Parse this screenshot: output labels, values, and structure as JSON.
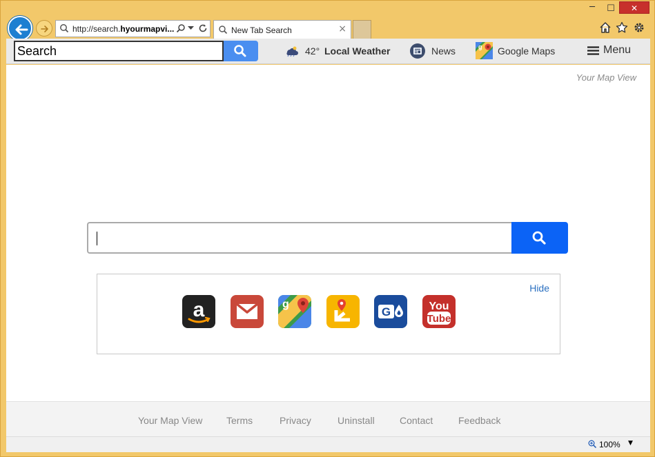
{
  "window": {
    "minimize": "─",
    "maximize": "☐",
    "close": "✕"
  },
  "address_bar": {
    "url_prefix": "http://search.",
    "url_bold": "hyourmapvi...",
    "search_icon": "search-icon",
    "dropdown_icon": "chevron-down-icon",
    "refresh_icon": "refresh-icon"
  },
  "tab": {
    "label": "New Tab Search",
    "close": "×"
  },
  "toolbar": {
    "search_value": "Search",
    "weather": {
      "temp": "42°",
      "label": "Local Weather"
    },
    "news": "News",
    "maps": "Google Maps",
    "menu": "Menu"
  },
  "content": {
    "brand": "Your Map View",
    "search_placeholder": "",
    "hide": "Hide",
    "shortcuts": [
      {
        "name": "amazon",
        "icon": "amazon-icon",
        "color": "#222222"
      },
      {
        "name": "gmail",
        "icon": "gmail-icon",
        "color": "#c9483a"
      },
      {
        "name": "google-maps",
        "icon": "google-maps-icon",
        "color": "#3d9b49"
      },
      {
        "name": "directions",
        "icon": "directions-icon",
        "color": "#f7b500"
      },
      {
        "name": "gasbuddy",
        "icon": "gasbuddy-icon",
        "color": "#1a4c9c"
      },
      {
        "name": "youtube",
        "icon": "youtube-icon",
        "color": "#c4302b"
      }
    ]
  },
  "footer": {
    "links": [
      "Your Map View",
      "Terms",
      "Privacy",
      "Uninstall",
      "Contact",
      "Feedback"
    ]
  },
  "status": {
    "zoom": "100%",
    "zoom_dropdown": "▼"
  },
  "colors": {
    "frame": "#f2c86a",
    "search_button": "#0b63f6",
    "toolbar_search_button": "#4a8ef0",
    "link": "#2a6fc0"
  }
}
